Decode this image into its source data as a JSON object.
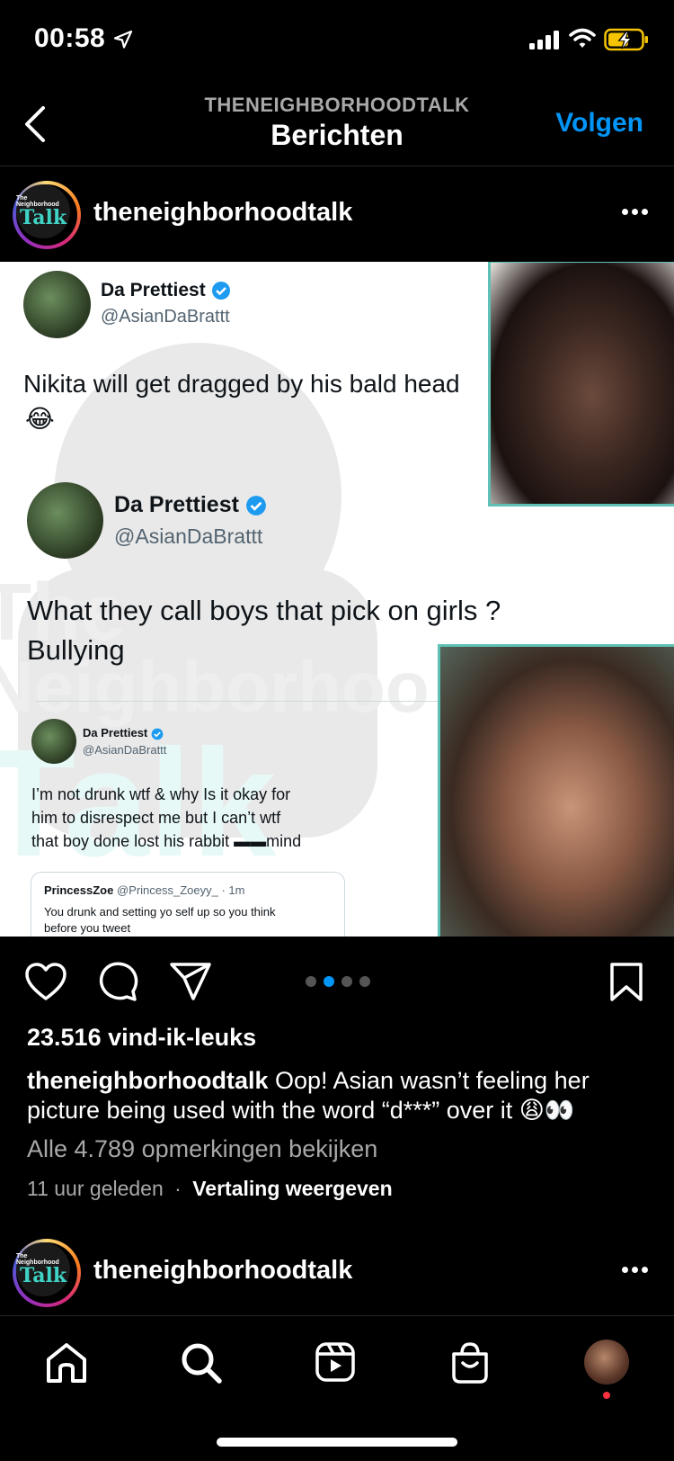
{
  "status_bar": {
    "time": "00:58",
    "icons": [
      "location-arrow-icon",
      "signal-icon",
      "wifi-icon",
      "battery-charging-icon"
    ]
  },
  "header": {
    "subtitle": "THENEIGHBORHOODTALK",
    "title": "Berichten",
    "follow_label": "Volgen"
  },
  "post": {
    "username": "theneighborhoodtalk",
    "avatar_logo": {
      "line1": "The Neighborhood",
      "line2": "Talk"
    },
    "image": {
      "watermark_text": "The Neighborhood Talk",
      "tweets": [
        {
          "name": "Da Prettiest",
          "handle": "@AsianDaBrattt",
          "text_lines": [
            "Nikita will get dragged by his bald head",
            "😂"
          ]
        },
        {
          "name": "Da Prettiest",
          "handle": "@AsianDaBrattt",
          "text_lines": [
            "What they call boys that pick on girls ?",
            "Bullying"
          ]
        },
        {
          "name": "Da Prettiest",
          "handle": "@AsianDaBrattt",
          "text_lines": [
            "I’m not drunk wtf & why Is it okay for",
            "him to disrespect me but I can’t wtf",
            "that boy done lost his rabbit ▬▬mind"
          ]
        }
      ],
      "quoted": {
        "name": "PrincessZoe",
        "handle": "@Princess_Zoeyy_ · 1m",
        "text_lines": [
          "You drunk and setting yo self up so you think",
          "before you tweet"
        ]
      }
    },
    "carousel": {
      "count": 4,
      "active_index": 1
    },
    "likes": "23.516 vind-ik-leuks",
    "caption_user": "theneighborhoodtalk",
    "caption_text": " Oop! Asian wasn’t feeling her picture being used with the word “d***” over it 😩👀",
    "view_comments": "Alle 4.789 opmerkingen bekijken",
    "time_ago": "11 uur geleden",
    "separator": "·",
    "translate_label": "Vertaling weergeven"
  },
  "next_post": {
    "username": "theneighborhoodtalk"
  },
  "bottom_nav": {
    "items": [
      "home-icon",
      "search-icon",
      "reels-icon",
      "shop-icon",
      "profile-avatar"
    ]
  },
  "colors": {
    "background": "#000000",
    "accent": "#0095f6",
    "muted": "#a8a8a8",
    "frame": "#5fc1b5",
    "notification": "#ff3040"
  }
}
